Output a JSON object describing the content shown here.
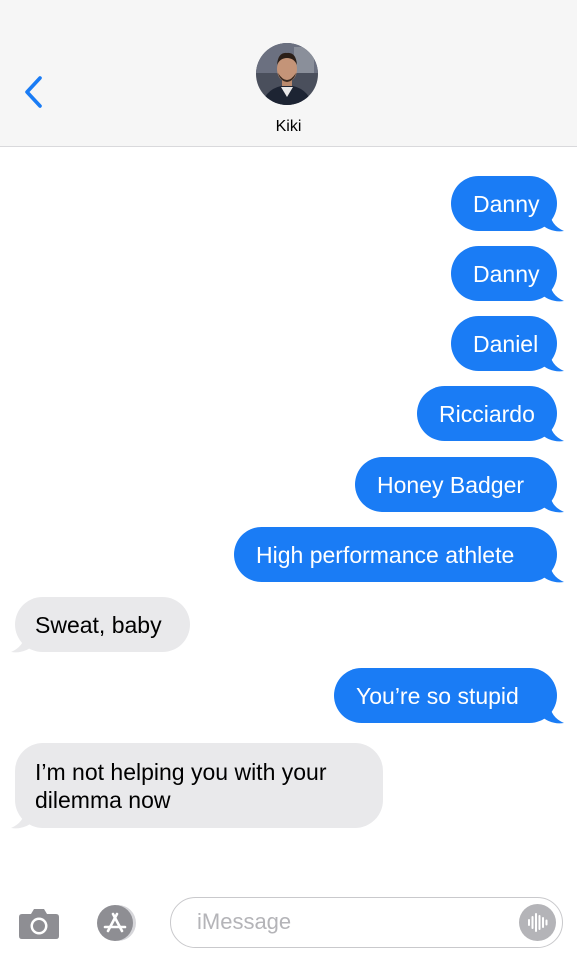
{
  "header": {
    "contact_name": "Kiki",
    "back_icon": "chevron-left-icon",
    "accent_color": "#1a7cf5"
  },
  "messages": [
    {
      "direction": "sent",
      "text": "Danny"
    },
    {
      "direction": "sent",
      "text": "Danny"
    },
    {
      "direction": "sent",
      "text": "Daniel"
    },
    {
      "direction": "sent",
      "text": "Ricciardo"
    },
    {
      "direction": "sent",
      "text": "Honey Badger"
    },
    {
      "direction": "sent",
      "text": "High performance athlete"
    },
    {
      "direction": "received",
      "text": "Sweat, baby"
    },
    {
      "direction": "sent",
      "text": "You’re so stupid"
    },
    {
      "direction": "received",
      "text": "I’m not helping you with your\ndilemma now"
    }
  ],
  "bottom_bar": {
    "camera_icon": "camera-icon",
    "apps_icon": "app-store-icon",
    "input_placeholder": "iMessage",
    "input_value": "",
    "audio_icon": "audio-waveform-icon"
  },
  "colors": {
    "sent_bubble": "#1a7cf5",
    "received_bubble": "#e9e9eb",
    "header_background": "#f6f6f6"
  }
}
